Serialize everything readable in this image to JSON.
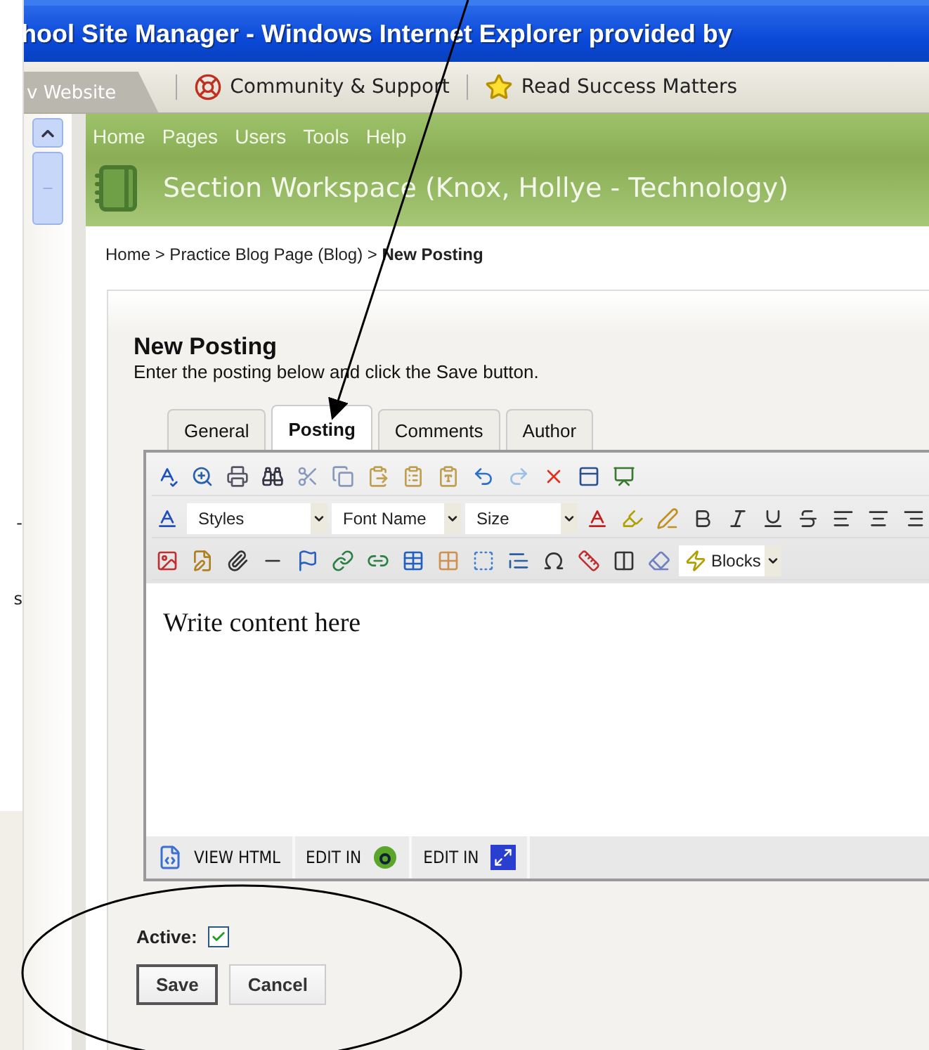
{
  "background_window": {
    "texts": [
      "-",
      "s"
    ]
  },
  "window": {
    "title": "hool Site Manager - Windows Internet Explorer provided by"
  },
  "browser_toolbar": {
    "tab": "v Website",
    "links": [
      "Community & Support",
      "Read Success Matters"
    ]
  },
  "nav_menu": [
    "Home",
    "Pages",
    "Users",
    "Tools",
    "Help"
  ],
  "workspace_title": "Section Workspace (Knox, Hollye - Technology)",
  "breadcrumb": "Home > Practice Blog Page (Blog) > **New Posting**",
  "form": {
    "heading": "New Posting",
    "description": "Enter the posting below and click the Save button.",
    "tabs": [
      {
        "label": "General",
        "selected": false
      },
      {
        "label": "Posting",
        "selected": true
      },
      {
        "label": "Comments",
        "selected": false
      },
      {
        "label": "Author",
        "selected": false
      }
    ],
    "editor": {
      "dropdowns": [
        "Styles",
        "Font Name",
        "Size"
      ],
      "blocks_dropdown": "Blocks",
      "content": "Write content here",
      "mode_buttons": [
        {
          "label": "VIEW HTML",
          "kind": "html"
        },
        {
          "label": "EDIT IN",
          "kind": "dreamweaver"
        },
        {
          "label": "EDIT IN",
          "kind": "external"
        }
      ]
    },
    "active": {
      "label": "Active:",
      "checked": true
    },
    "buttons": [
      "Save",
      "Cancel"
    ]
  }
}
